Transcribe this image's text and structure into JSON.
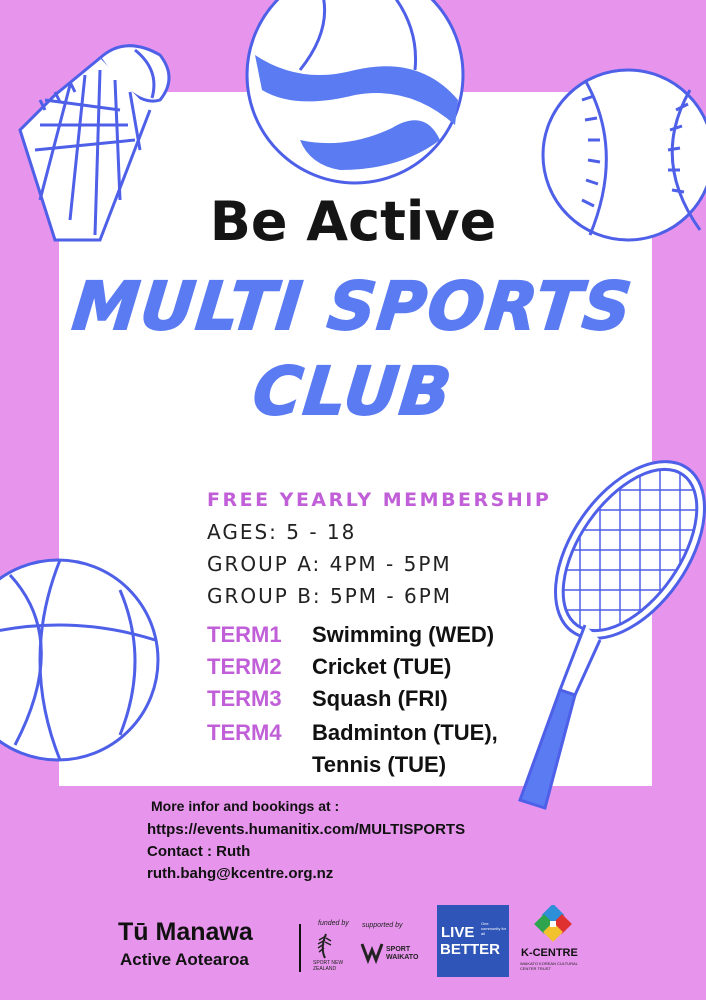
{
  "header": {
    "be_active": "Be Active",
    "headline_line1": "MULTI SPORTS",
    "headline_line2": "CLUB"
  },
  "details": {
    "membership": "FREE YEARLY MEMBERSHIP",
    "ages": "AGES: 5 - 18",
    "group_a": "GROUP A: 4PM - 5PM",
    "group_b": "GROUP B: 5PM - 6PM"
  },
  "terms": [
    {
      "label": "TERM1",
      "sport": "Swimming (WED)"
    },
    {
      "label": "TERM2",
      "sport": "Cricket (TUE)"
    },
    {
      "label": "TERM3",
      "sport": "Squash (FRI)"
    },
    {
      "label": "TERM4",
      "sport": "Badminton (TUE),",
      "sport_line2": "Tennis (TUE)"
    }
  ],
  "contact": {
    "bookings_intro": "More infor and bookings at :",
    "url": "https://events.humanitix.com/MULTISPORTS",
    "contact_label": "Contact : Ruth",
    "email": "ruth.bahg@kcentre.org.nz"
  },
  "footer": {
    "org_line1": "Tū Manawa",
    "org_line2": "Active Aotearoa",
    "funded_by": "funded by",
    "sport_nz": "SPORT NEW ZEALAND",
    "supported_by": "supported by",
    "sport_waikato": "SPORT WAIKATO",
    "live_better_line1": "LIVE",
    "live_better_line2": "BETTER",
    "live_better_tagline": "One community for all",
    "kcentre_name": "K-CENTRE",
    "kcentre_sub": "WAIKATO KOREAN CULTURAL CENTER TRUST"
  },
  "colors": {
    "background": "#e795ec",
    "accent_blue": "#5a7bf2",
    "accent_purple": "#c05fd8",
    "live_better_blue": "#2f55b8"
  },
  "icons": [
    "shuttlecock-icon",
    "volleyball-icon",
    "baseball-icon",
    "basketball-icon",
    "tennis-racket-icon",
    "fern-icon",
    "sport-waikato-icon",
    "kcentre-logo-icon"
  ]
}
